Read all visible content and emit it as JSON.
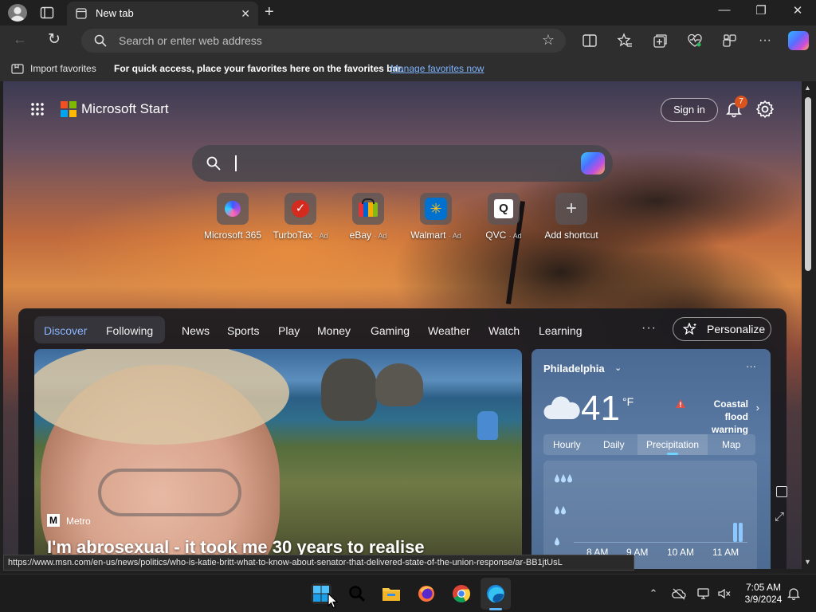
{
  "browser": {
    "tab_title": "New tab",
    "address_placeholder": "Search or enter web address",
    "favorites_bar": {
      "import": "Import favorites",
      "tip": "For quick access, place your favorites here on the favorites bar.",
      "manage_link": "Manage favorites now"
    },
    "status_url": "https://www.msn.com/en-us/news/politics/who-is-katie-britt-what-to-know-about-senator-that-delivered-state-of-the-union-response/ar-BB1jtUsL"
  },
  "start": {
    "brand": "Microsoft Start",
    "sign_in": "Sign in",
    "notification_count": "7",
    "shortcuts": [
      {
        "label": "Microsoft 365",
        "ad": ""
      },
      {
        "label": "TurboTax",
        "ad": "· Ad"
      },
      {
        "label": "eBay",
        "ad": "· Ad"
      },
      {
        "label": "Walmart",
        "ad": "· Ad"
      },
      {
        "label": "QVC",
        "ad": "· Ad"
      },
      {
        "label": "Add shortcut",
        "ad": ""
      }
    ]
  },
  "feed": {
    "tabs": [
      "Discover",
      "Following",
      "News",
      "Sports",
      "Play",
      "Money",
      "Gaming",
      "Weather",
      "Watch",
      "Learning"
    ],
    "more": "···",
    "personalize": "Personalize",
    "hero": {
      "source": "Metro",
      "source_logo": "M",
      "headline": "I'm abrosexual - it took me 30 years to realise"
    }
  },
  "weather": {
    "city": "Philadelphia",
    "more": "···",
    "temperature": "41",
    "unit": "°F",
    "alert": "Coastal flood warning",
    "tabs": [
      "Hourly",
      "Daily",
      "Precipitation",
      "Map"
    ],
    "active_tab": "Precipitation",
    "precip_levels": [
      "💧💧💧",
      "💧💧",
      "💧"
    ],
    "time_labels": [
      "8 AM",
      "9 AM",
      "10 AM",
      "11 AM"
    ]
  },
  "taskbar": {
    "time": "7:05 AM",
    "date": "3/9/2024"
  },
  "colors": {
    "accent_link": "#7eb4ff",
    "active_tab_blue": "#8ab4ff",
    "notification_badge": "#d9531e"
  }
}
